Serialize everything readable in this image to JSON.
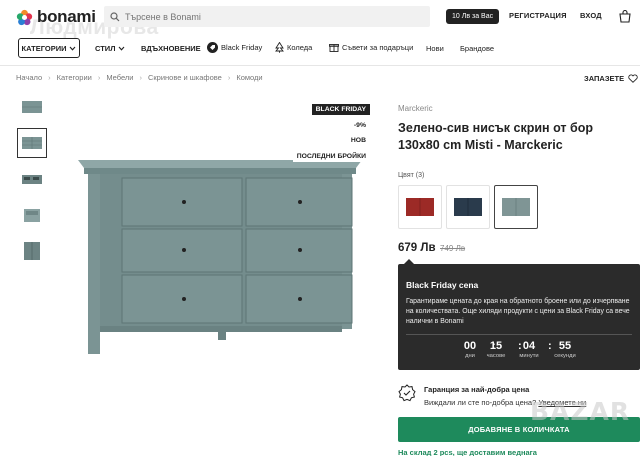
{
  "header": {
    "logo_text": "bonami",
    "search_placeholder": "Търсене в Bonami",
    "promo_pill": "10 Лв за Вас",
    "register_label": "РЕГИСТРАЦИЯ",
    "login_label": "ВХОД",
    "watermark_name": "Людмирова"
  },
  "nav": {
    "categories_label": "КАТЕГОРИИ",
    "items": [
      "СТИЛ",
      "ВДЪХНОВЕНИЕ",
      "Black Friday",
      "Коледа",
      "Съвети за подаръци",
      "Нови",
      "Брандове"
    ]
  },
  "breadcrumb": [
    "Начало",
    "Категории",
    "Мебели",
    "Скринове и шкафове",
    "Комоди"
  ],
  "save_label": "ЗАПАЗЕТЕ",
  "badges": {
    "black_friday": "BLACK FRIDAY",
    "discount": "-9%",
    "new": "НОВ",
    "last_items": "ПОСЛЕДНИ БРОЙКИ"
  },
  "product": {
    "brand": "Marckeric",
    "title": "Зелено-сив нисък скрин от бор 130x80 cm Misti - Marckeric",
    "color_label": "Цвят (3)",
    "price": "679 Лв",
    "old_price": "749 Лв"
  },
  "tooltip": {
    "title": "Black Friday cena",
    "body": "Гарантираме цената до края на обратното броене или до изчерпване на количествата. Още хиляди продукти с цени за Black Friday са вече налични в Bonami",
    "countdown": [
      {
        "value": "00",
        "label": "дни"
      },
      {
        "value": "15",
        "label": "часове"
      },
      {
        "value": "04",
        "label": "минути"
      },
      {
        "value": "55",
        "label": "секунди"
      }
    ]
  },
  "guarantee": {
    "title": "Гаранция за най-добра цена",
    "text": "Виждали ли сте по-добра цена?",
    "link": "Уведомете ни"
  },
  "add_to_cart_label": "ДОБАВЯНЕ В КОЛИЧКАТА",
  "stock_text": "На склад 2 pcs, ще доставим веднага",
  "overlay_watermark": "BAZAR",
  "colors": {
    "accent_green": "#1e8a5c",
    "dresser": "#7b9494",
    "swatch_red": "#9c2a26",
    "swatch_navy": "#2a3b4c",
    "swatch_sage": "#7f9595"
  }
}
